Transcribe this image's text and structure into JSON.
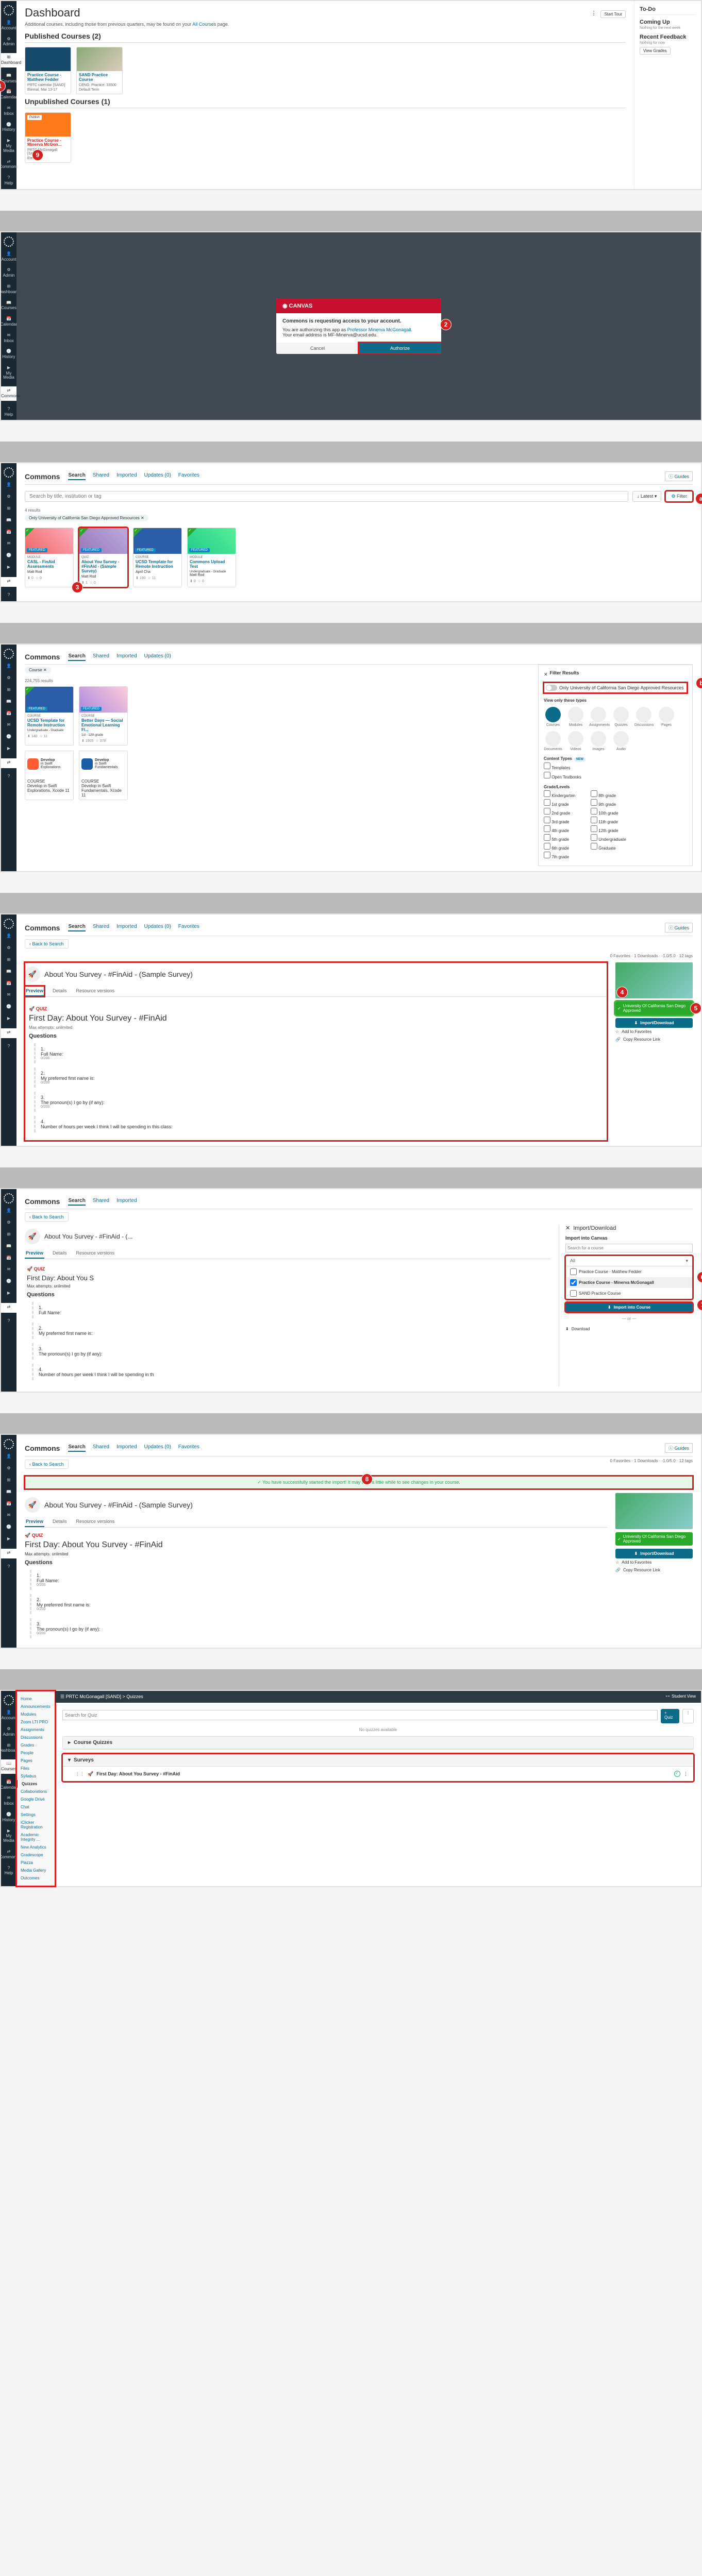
{
  "nav": {
    "items": [
      "Account",
      "Admin",
      "Dashboard",
      "Courses",
      "Calendar",
      "Inbox",
      "History",
      "My Media",
      "Commons",
      "Help"
    ],
    "active_idx": {
      "s1": 2,
      "s2": 8,
      "s3": 8,
      "s4": 8,
      "s5": 8,
      "s6": 8,
      "s7": 8,
      "s8": 3
    }
  },
  "section1": {
    "title": "Dashboard",
    "info": "Additional courses, including those from previous quarters, may be found on your",
    "info_link": "All Courses",
    "info_end": "page.",
    "pub_header": "Published Courses (2)",
    "unpub_header": "Unpublished Courses (1)",
    "published": [
      {
        "title": "Practice Course - Matthew Fedder",
        "sub": "PRTC calendar [SAND]",
        "term": "Eternal, Mar 13-17",
        "color": "#154a6a"
      },
      {
        "title": "SAND Practice Course",
        "sub": "CENG: Practice: 33500",
        "term": "Default Term",
        "img": "photo"
      }
    ],
    "unpublished": [
      {
        "badge": "Publish",
        "title": "Practice Course - Minerva McGon...",
        "sub": "PRTC McGonagall [SAND]",
        "term": "Eternal",
        "color": "#ff7a1a"
      }
    ],
    "side": {
      "todo": "To-Do",
      "coming": "Coming Up",
      "coming_sub": "Nothing for the next week",
      "feedback": "Recent Feedback",
      "feedback_sub": "Nothing for now",
      "view_grades": "View Grades"
    },
    "start_tour": "Start Tour"
  },
  "section2": {
    "modal": {
      "canvas_logo": "CANVAS",
      "heading": "Commons is requesting access to your account.",
      "line": "You are authorizing this app as",
      "user": "Professor Minerva McGonagall",
      "email_line": "Your email address is MF-Minerva@ucsd.edu.",
      "cancel": "Cancel",
      "authorize": "Authorize"
    }
  },
  "commons_header": {
    "brand": "Commons",
    "tabs": [
      "Search",
      "Shared",
      "Imported",
      "Updates (0)",
      "Favorites"
    ],
    "guides": "Guides"
  },
  "section3": {
    "search_placeholder": "Search by title, institution or tag",
    "sort": "Latest",
    "filter": "Filter",
    "results": "4 results",
    "chip": "Only University of California San Diego Approved Resources",
    "cards": [
      {
        "check": true,
        "featured": true,
        "type": "MODULE",
        "title": "CASL - FinAid Assessments",
        "author": "Matt Rod",
        "dl": "0",
        "fav": "0",
        "bg": "linear-gradient(45deg,#e66,#fab)"
      },
      {
        "check": true,
        "featured": true,
        "type": "QUIZ",
        "title": "About You Survey - #FinAid - (Sample Survey)",
        "author": "Matt Rod",
        "dl": "1",
        "fav": "0",
        "bg": "linear-gradient(45deg,#97b,#bad)"
      },
      {
        "check": true,
        "featured": true,
        "type": "COURSE",
        "title": "UCSD Template for Remote Instruction",
        "author": "April Cha",
        "dl": "190",
        "fav": "11",
        "bg": "#2a5da8"
      },
      {
        "check": true,
        "featured": true,
        "type": "MODULE",
        "title": "Commons Upload Test",
        "author": "Matt Rod",
        "grade": "Undergraduate - Graduate",
        "dl": "0",
        "fav": "0",
        "bg": "linear-gradient(45deg,#2c8,#5e9)"
      }
    ]
  },
  "section4": {
    "results": "224,755 results",
    "chip": "Course",
    "cards": [
      {
        "check": true,
        "featured": true,
        "type": "COURSE",
        "title": "UCSD Template for Remote Instruction",
        "grade": "Undergraduate - Graduate",
        "dl": "140",
        "fav": "11",
        "bg": "#2a5da8"
      },
      {
        "featured": true,
        "type": "COURSE",
        "title": "Better Days — Social Emotional Learning Fl...",
        "grade": "1st - 12th grade",
        "dl": "1905",
        "fav": "378",
        "bg": "linear-gradient(45deg,#a8d,#fcd)"
      }
    ],
    "swift": [
      {
        "big": "Develop",
        "small": "in Swift",
        "sub": "Explorations",
        "title": "Develop in Swift Explorations, Xcode 11",
        "bg": "#ff5b33"
      },
      {
        "big": "Develop",
        "small": "in Swift",
        "sub": "Fundamentals",
        "title": "Develop in Swift Fundamentals, Xcode 11",
        "bg": "#1a5da8"
      }
    ],
    "filter": {
      "title": "Filter Results",
      "approved": "Only University of California San Diego Approved Resources",
      "view_types": "View only these types",
      "types": [
        "Courses",
        "Modules",
        "Assignments",
        "Quizzes",
        "Discussions",
        "Pages",
        "Documents",
        "Videos",
        "Images",
        "Audio"
      ],
      "content_types": "Content Types",
      "new": "NEW",
      "ct": [
        "Templates",
        "Open Textbooks"
      ],
      "grade_heading": "Grade/Levels",
      "grades_left": [
        "Kindergarten",
        "1st grade",
        "2nd grade",
        "3rd grade",
        "4th grade",
        "5th grade",
        "6th grade",
        "7th grade"
      ],
      "grades_right": [
        "8th grade",
        "9th grade",
        "10th grade",
        "11th grade",
        "12th grade",
        "Undergraduate",
        "Graduate"
      ]
    }
  },
  "section5": {
    "back": "Back to Search",
    "meta": "0 Favorites · 1 Downloads · -1.0/5.0 · 12 tags",
    "title": "About You Survey - #FinAid - (Sample Survey)",
    "tabs": [
      "Preview",
      "Details",
      "Resource versions"
    ],
    "quiz_label": "QUIZ",
    "quiz_title": "First Day: About You Survey - #FinAid",
    "attempts": "Max attempts: unlimited",
    "questions_heading": "Questions",
    "questions": [
      {
        "n": "1.",
        "text": "Full Name:",
        "pts": "0/200"
      },
      {
        "n": "2.",
        "text": "My preferred first name is:",
        "pts": "0/200"
      },
      {
        "n": "3.",
        "text": "The pronoun(s) I go by (if any):",
        "pts": "0/200"
      },
      {
        "n": "4.",
        "text": "Number of hours per week I think I will be spending in this class:"
      }
    ],
    "right": {
      "badge": "University Of California San Diego Approved",
      "import": "Import/Download",
      "add_fav": "Add to Favorites",
      "copy": "Copy Resource Link"
    }
  },
  "section6": {
    "panel_title": "Import/Download",
    "into_canvas": "Import into Canvas",
    "search_ph": "Search for a course",
    "all": "All",
    "courses": [
      {
        "name": "Practice Course - Matthew Fedder",
        "checked": false
      },
      {
        "name": "Practice Course - Minerva McGonagall",
        "checked": true
      },
      {
        "name": "SAND Practice Course",
        "checked": false
      }
    ],
    "import_btn": "Import into Course",
    "or": "— or —",
    "download": "Download"
  },
  "section7": {
    "success": "You have successfully started the import! It may take a little while to see changes in your course."
  },
  "section8": {
    "crumb": "PRTC McGonagall [SAND] > Quizzes",
    "student_view": "Student View",
    "search_ph": "Search for Quiz",
    "add_quiz": "+ Quiz",
    "no_quizzes": "No quizzes available",
    "group": "Course Quizzes",
    "survey_group": "Surveys",
    "survey_item": "First Day: About You Survey - #FinAid",
    "nav_items": [
      "Home",
      "Announcements",
      "Modules",
      "Zoom LTI PRO",
      "Assignments",
      "Discussions",
      "Grades",
      "People",
      "Pages",
      "Files",
      "Syllabus",
      "Quizzes",
      "Collaborations",
      "Google Drive",
      "Chat",
      "Settings",
      "iClicker Registration",
      "Academic Integrity ...",
      "New Analytics",
      "Gradescope",
      "Piazza",
      "Media Gallery",
      "Outcomes"
    ],
    "active": "Quizzes"
  }
}
